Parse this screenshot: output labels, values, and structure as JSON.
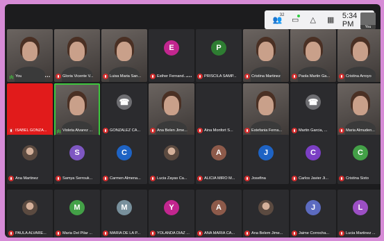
{
  "toolbar": {
    "participants_count": "32",
    "clock": "5:34 PM",
    "self_label": "You"
  },
  "video_tiles": [
    {
      "name": "You",
      "kind": "photo",
      "muted": false,
      "more": true
    },
    {
      "name": "Gloria Vicente V...",
      "kind": "photo",
      "muted": true
    },
    {
      "name": "Luisa Maria San...",
      "kind": "photo",
      "muted": true
    },
    {
      "name": "Esther Fernand...",
      "kind": "letter",
      "letter": "E",
      "color": "#c2268f",
      "muted": true,
      "more": true
    },
    {
      "name": "PRISCILA SAMP...",
      "kind": "letter",
      "letter": "P",
      "color": "#2e7d32",
      "muted": true
    },
    {
      "name": "Cristina Martinez",
      "kind": "photo",
      "muted": true
    },
    {
      "name": "Paola Martin Ga...",
      "kind": "photo",
      "muted": true
    },
    {
      "name": "Cristina Arroyo",
      "kind": "photo",
      "muted": true
    },
    {
      "name": "ISABEL GONZA...",
      "kind": "red",
      "muted": true
    },
    {
      "name": "Violeta Alvarez ...",
      "kind": "photo",
      "muted": false,
      "speaking": true
    },
    {
      "name": "GONZALEZ CA...",
      "kind": "phone",
      "muted": true
    },
    {
      "name": "Ana Belen Jime...",
      "kind": "photo",
      "muted": true
    },
    {
      "name": "Aina Monfort S...",
      "kind": "dark",
      "muted": true
    },
    {
      "name": "Estefania Ferna...",
      "kind": "photo",
      "muted": true
    },
    {
      "name": "Martin Garcia, ...",
      "kind": "phone",
      "muted": true
    },
    {
      "name": "Maria Almuden...",
      "kind": "photo",
      "muted": true
    }
  ],
  "avatar_tiles": [
    {
      "name": "Ana Martinez",
      "kind": "photo"
    },
    {
      "name": "Samya Serrouk...",
      "kind": "letter",
      "letter": "S",
      "color": "#7e57c2"
    },
    {
      "name": "Carmen Almena...",
      "kind": "letter",
      "letter": "C",
      "color": "#1e63c4"
    },
    {
      "name": "Lucia Zayas Ca...",
      "kind": "photo"
    },
    {
      "name": "ALICIA MIRO M...",
      "kind": "letter",
      "letter": "A",
      "color": "#8d5a4a"
    },
    {
      "name": "Josefina",
      "kind": "letter",
      "letter": "J",
      "color": "#1e63c4"
    },
    {
      "name": "Carlos Javier Ji...",
      "kind": "letter",
      "letter": "C",
      "color": "#7b3fc4"
    },
    {
      "name": "Cristina Sixto",
      "kind": "letter",
      "letter": "C",
      "color": "#43a047"
    },
    {
      "name": "PAULA ALVARE...",
      "kind": "photo"
    },
    {
      "name": "Maria Del Pilar ...",
      "kind": "letter",
      "letter": "M",
      "color": "#43a047"
    },
    {
      "name": "MARIA DE LA P...",
      "kind": "letter",
      "letter": "M",
      "color": "#78909c"
    },
    {
      "name": "YOLANDA DIAZ ...",
      "kind": "letter",
      "letter": "Y",
      "color": "#c2268f"
    },
    {
      "name": "ANA MARIA CA...",
      "kind": "letter",
      "letter": "A",
      "color": "#8d5a4a"
    },
    {
      "name": "Ana Belem Jime...",
      "kind": "photo"
    },
    {
      "name": "Jaime Corrocha...",
      "kind": "letter",
      "letter": "J",
      "color": "#5c6bc0"
    },
    {
      "name": "Lucia Martinez ...",
      "kind": "letter",
      "letter": "L",
      "color": "#9c4fc4"
    }
  ]
}
